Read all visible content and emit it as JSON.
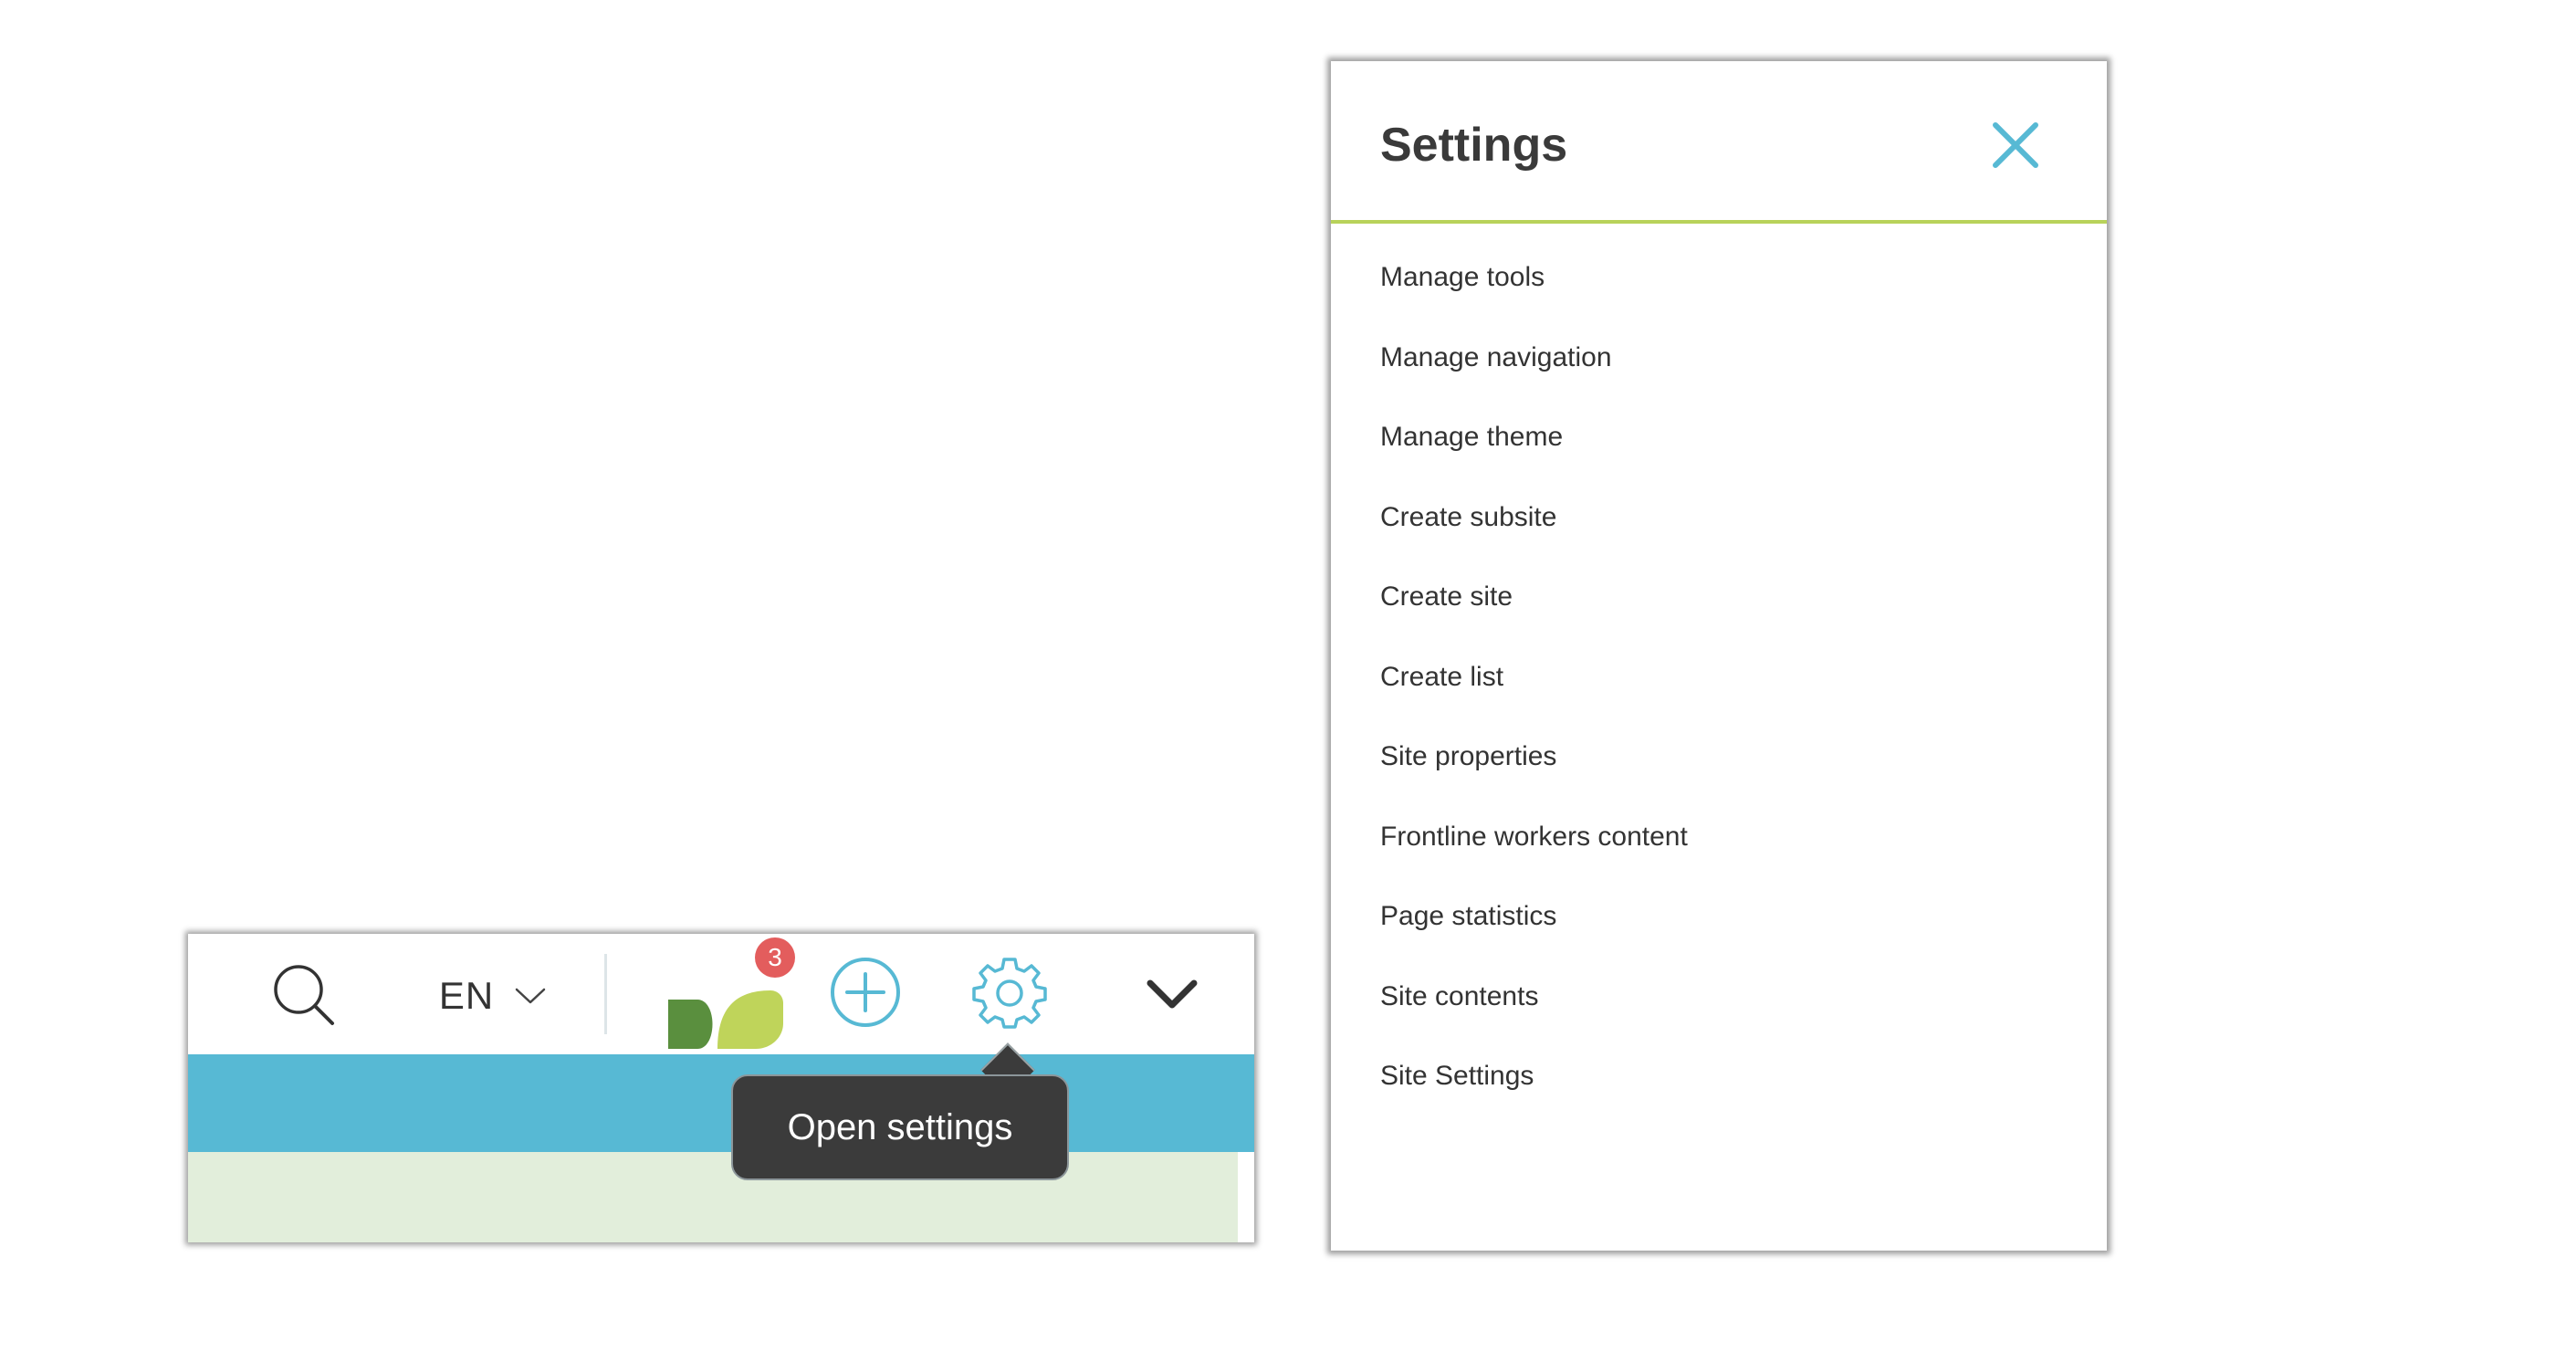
{
  "toolbar": {
    "search_icon": "search-icon",
    "language_code": "EN",
    "language_chevron_icon": "chevron-down-icon",
    "app_logo_icon": "leaf-logo-icon",
    "notification_count": "3",
    "add_icon": "plus-circle-icon",
    "settings_icon": "gear-icon",
    "expand_icon": "chevron-down-icon",
    "tooltip_text": "Open settings"
  },
  "settings_panel": {
    "title": "Settings",
    "close_icon": "close-icon",
    "items": [
      {
        "label": "Manage tools"
      },
      {
        "label": "Manage navigation"
      },
      {
        "label": "Manage theme"
      },
      {
        "label": "Create subsite"
      },
      {
        "label": "Create site"
      },
      {
        "label": "Create list"
      },
      {
        "label": "Site properties"
      },
      {
        "label": "Frontline workers content"
      },
      {
        "label": "Page statistics"
      },
      {
        "label": "Site contents"
      },
      {
        "label": "Site Settings"
      }
    ]
  },
  "colors": {
    "accent_blue": "#57b9d4",
    "accent_green": "#b8d25a",
    "leaf_dark": "#5a8f3e",
    "leaf_light": "#bfd45a",
    "badge_red": "#e35d5d",
    "tooltip_bg": "#3b3b3b",
    "content_bg": "#e2eedb"
  }
}
